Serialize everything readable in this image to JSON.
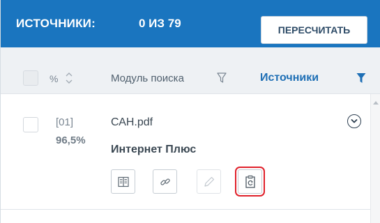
{
  "header": {
    "title": "ИСТОЧНИКИ:",
    "count": "0 ИЗ 79",
    "recalc_label": "ПЕРЕСЧИТАТЬ",
    "bg_color": "#1a75bf"
  },
  "columns": {
    "percent_label": "%",
    "module_label": "Модуль поиска",
    "sources_label": "Источники"
  },
  "row": {
    "index": "[01]",
    "percent": "96,5%",
    "file_name": "САН.pdf",
    "source_name": "Интернет Плюс",
    "actions": [
      {
        "icon": "book-icon",
        "disabled": false
      },
      {
        "icon": "link-icon",
        "disabled": false
      },
      {
        "icon": "pencil-icon",
        "disabled": true
      },
      {
        "icon": "clipboard-refresh-icon",
        "disabled": false,
        "highlighted": true
      }
    ]
  },
  "colors": {
    "accent": "#1e6fb5",
    "highlight": "#e0202a"
  }
}
